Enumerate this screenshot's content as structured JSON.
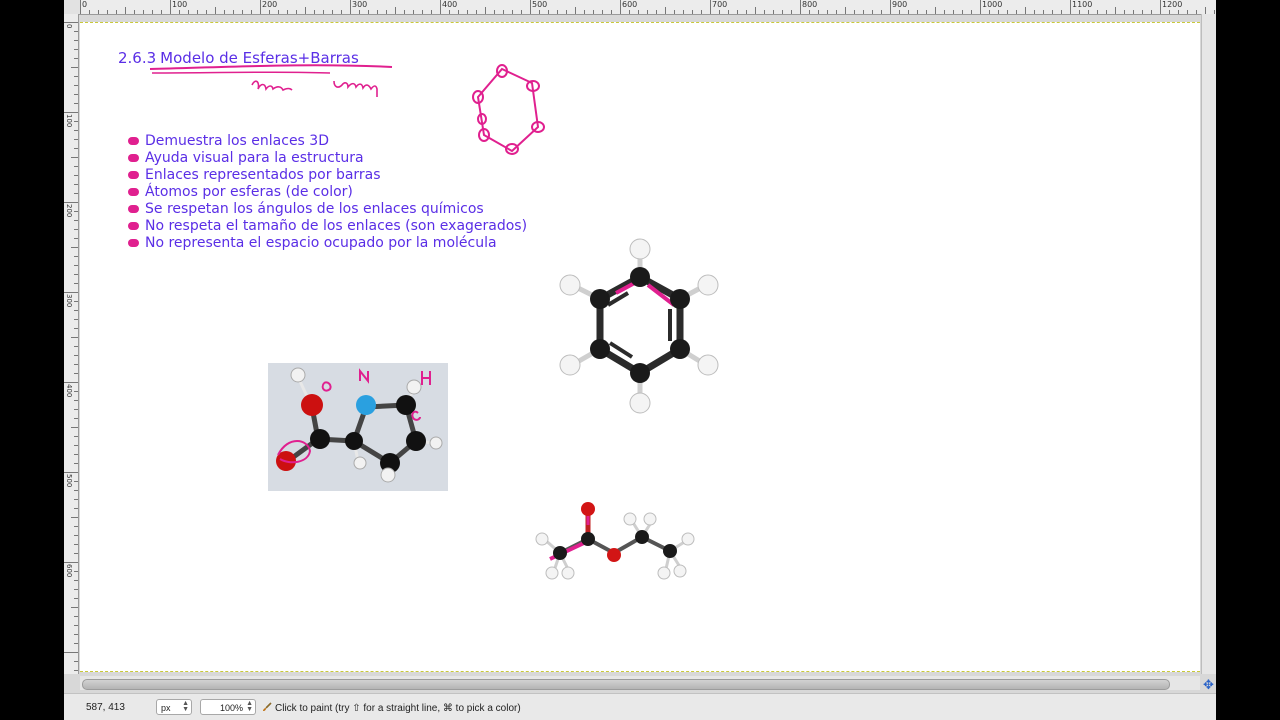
{
  "ruler": {
    "top_labels": [
      "0",
      "100",
      "200",
      "300",
      "400",
      "500",
      "600",
      "700",
      "800",
      "900",
      "1000",
      "1100",
      "1200"
    ],
    "left_labels": [
      "0",
      "100",
      "200",
      "300",
      "400",
      "500",
      "600"
    ]
  },
  "slide": {
    "number": "2.6.3",
    "title": "Modelo de Esferas+Barras",
    "bullets": [
      "Demuestra los enlaces 3D",
      "Ayuda visual para la estructura",
      "Enlaces representados por barras",
      "Átomos por esferas (de color)",
      "Se respetan los ángulos de los enlaces químicos",
      "No respeta el tamaño de los enlaces (son exagerados)",
      "No representa el espacio ocupado por la molécula"
    ]
  },
  "statusbar": {
    "coords": "587, 413",
    "unit": "px",
    "zoom": "100%",
    "hint": "Click to paint (try ⇧ for a straight line, ⌘ to pick a color)"
  },
  "colors": {
    "text": "#5a2ee6",
    "ink": "#e0208f",
    "carbon": "#1a1a1a",
    "hydrogen": "#f4f4f4",
    "oxygen": "#d21515",
    "nitrogen": "#2aa0e0"
  },
  "icons": {
    "brush": "paintbrush-icon",
    "navigate": "navigate-crosshair-icon"
  }
}
